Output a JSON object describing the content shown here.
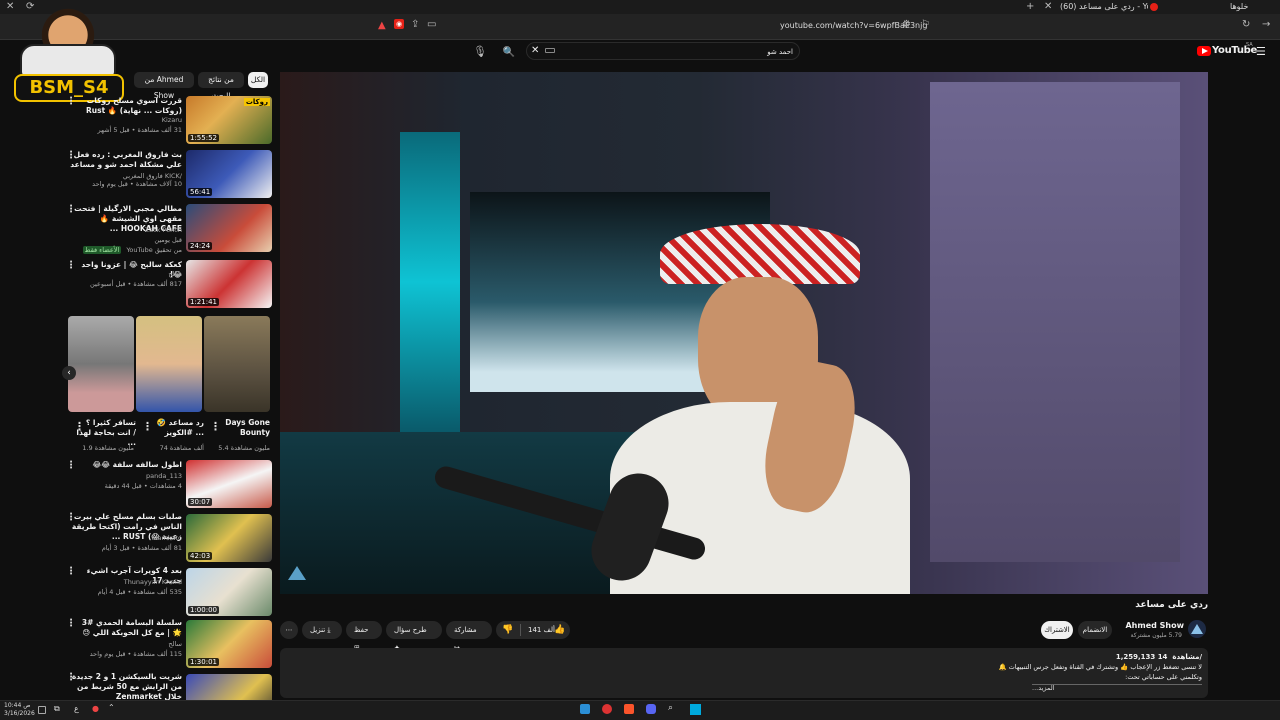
{
  "browser": {
    "tab_active": "(60) ردي على مساعد - YouTube",
    "tab_other": "خلوها",
    "url": "youtube.com/watch?v=6wpfBaE3njg"
  },
  "watermark": {
    "text": "BSM_S4"
  },
  "header": {
    "logo": "YouTube",
    "region": "SA",
    "search_value": "احمد شو",
    "search_placeholder": ""
  },
  "chips": [
    "الكل",
    "من نتائج البحث",
    "من Ahmed Show"
  ],
  "recommendations": [
    {
      "title": "قررت اسوي مسلح روكات (روكات ... نهاية) 🔥 Rust",
      "channel": "Kizaru",
      "meta": "31 ألف مشاهدة • قبل 5 أشهر",
      "duration": "1:55:52"
    },
    {
      "title": "بث فاروق المغربي : رده فعل علي مشكلة احمد شو و مساعد",
      "channel": "فاروق المغربي KICK/",
      "meta": "10 آلاف مشاهدة • قبل يوم واحد",
      "duration": "56:41"
    },
    {
      "title": "مطالي مجبي الارگيلة | فتحت مقهى اوي الشيشة 🔥 HOOKAH CAFE ...",
      "channel": "Zack Ponch",
      "meta": "من تحقيق YouTube",
      "badge": "الأعضاء فقط",
      "sub": "قبل يومين",
      "duration": "24:24"
    },
    {
      "title": "كعكة سالبح 😂 | عزونا واحد 😂!",
      "channel": "سالح",
      "meta": "817 ألف مشاهدة • قبل أسبوعين",
      "duration": "1:21:41"
    }
  ],
  "shorts": [
    {
      "title": "Days Gone Bounty",
      "views": "5.4 مليون مشاهدة"
    },
    {
      "title": "رد مساعد 🤣 #الكويز ...",
      "views": "74 ألف مشاهدة"
    },
    {
      "title": "تسافر كثيرا ؟ انت بحاجة لهذا / ...",
      "views": "1.9 مليون مشاهدة"
    }
  ],
  "recommendations2": [
    {
      "title": "اطول سالفه سلفة 😂😂",
      "channel": "panda_113",
      "meta": "4 مشاهدات • قبل 44 دقيقة",
      "duration": "30:07"
    },
    {
      "title": "صلبات بسلم مسلح علي بيرت الناس في رامت (اكتحا طريقة زعيبة 😱) RUST ...",
      "channel": "Mamkato",
      "meta": "81 ألف مشاهدة • قبل 3 أيام",
      "duration": "42:03"
    },
    {
      "title": "بعد 4 كويرات آجرب اشيء جديد 17",
      "channel": "Thunayyan Khalid",
      "meta": "535 ألف مشاهدة • قبل 4 أيام",
      "duration": "1:00:00"
    },
    {
      "title": "سلسلة البسامة الحمدي #3 🌟 | مع كل الحوبكة اللي 😓",
      "channel": "سالح",
      "meta": "115 ألف مشاهدة • قبل يوم واحد",
      "duration": "1:30:01"
    },
    {
      "title": "شريت بالسيكشن 1 و 2 جديدة من الرابش مع 50 شريط من خلال Zenmarket",
      "channel": "",
      "meta": "",
      "duration": ""
    }
  ],
  "video": {
    "title": "ردي على مساعد",
    "channel": "Ahmed Show",
    "subs": "5.79 مليون مشتركة",
    "join": "الانضمام",
    "subscribe": "الاشتراك",
    "likes": "141 ألف",
    "share": "مشاركة",
    "ask": "طرح سؤال",
    "save": "حفظ",
    "download": "تنزيل",
    "views": "1,259,133 مشاهدة",
    "age": "14/",
    "desc1": "لا تنسى تضغط زر الإعجاب 👍 وتشترك في القناة وتفعل جرس التنبيهات 🔔",
    "desc2": "وتكلمني على حساباتي تحت:",
    "more": "...المزيد"
  },
  "taskbar": {
    "time": "10:44 ص",
    "date": "3/16/2026",
    "lang": "ع"
  },
  "colors": {
    "accent": "#ff0000",
    "bg": "#0f0f0f",
    "pill": "#272727"
  }
}
